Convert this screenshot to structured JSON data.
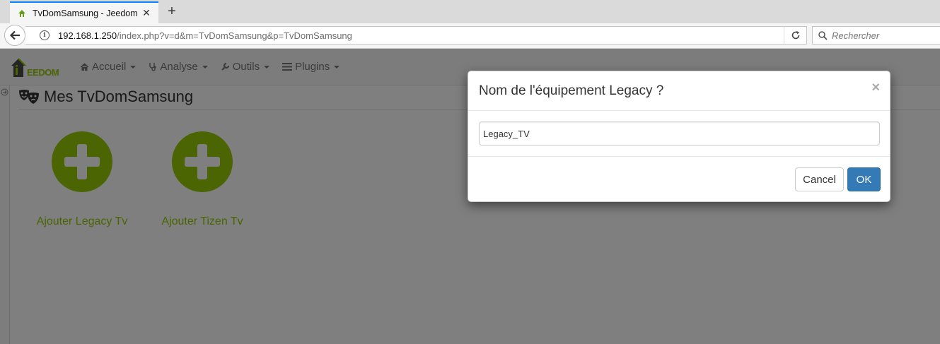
{
  "browser": {
    "tab_title": "TvDomSamsung - Jeedom",
    "tab_close": "✕",
    "new_tab": "+",
    "url_host": "192.168.1.250",
    "url_path": "/index.php?v=d&m=TvDomSamsung&p=TvDomSamsung",
    "search_placeholder": "Rechercher"
  },
  "app": {
    "logo_text": "EEDOM",
    "menu": [
      {
        "label": "Accueil",
        "icon": "home-icon"
      },
      {
        "label": "Analyse",
        "icon": "stethoscope-icon"
      },
      {
        "label": "Outils",
        "icon": "wrench-icon"
      },
      {
        "label": "Plugins",
        "icon": "list-icon"
      }
    ],
    "page_title": "Mes TvDomSamsung",
    "cards": [
      {
        "label": "Ajouter Legacy Tv"
      },
      {
        "label": "Ajouter Tizen Tv"
      }
    ],
    "accent_color": "#94ca02"
  },
  "modal": {
    "title": "Nom de l'équipement Legacy ?",
    "close": "×",
    "input_value": "Legacy_TV",
    "cancel_label": "Cancel",
    "ok_label": "OK"
  }
}
